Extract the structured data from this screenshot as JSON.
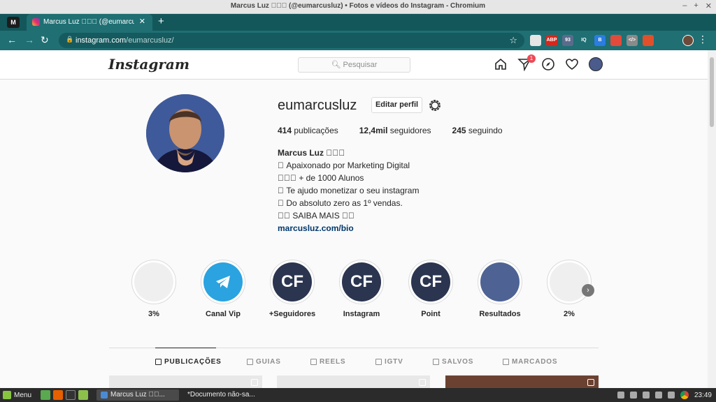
{
  "window": {
    "title": "Marcus Luz 󰀀󰀀󰀀 (@eumarcusluz) • Fotos e vídeos do Instagram - Chromium"
  },
  "browser": {
    "tab_title": "Marcus Luz 󰀀󰀀󰀀 (@eumarcusluz) • Instagram",
    "url_host": "instagram.com",
    "url_path": "/eumarcusluz/",
    "extensions": [
      {
        "name": "ext-icon",
        "label": "",
        "color": "#e5e5e5"
      },
      {
        "name": "adblock-plus-icon",
        "label": "ABP",
        "color": "#d9261c"
      },
      {
        "name": "ext-counter-icon",
        "label": "93",
        "color": "#5a6b8c"
      },
      {
        "name": "ext-iq-icon",
        "label": "IQ",
        "color": "#1f6f73"
      },
      {
        "name": "ext-b-icon",
        "label": "B",
        "color": "#2a7de1"
      },
      {
        "name": "ext-pin-icon",
        "label": "",
        "color": "#e24a3b"
      },
      {
        "name": "ext-code-icon",
        "label": "</>",
        "color": "#8a8a8a"
      },
      {
        "name": "ext-grid-icon",
        "label": "",
        "color": "#e0502b"
      },
      {
        "name": "puzzle-icon",
        "label": "",
        "color": "#1f6f73"
      }
    ]
  },
  "instagram": {
    "logo": "Instagram",
    "search_placeholder": "Pesquisar",
    "notification_count": "1"
  },
  "profile": {
    "username": "eumarcusluz",
    "edit_label": "Editar perfil",
    "stats": [
      {
        "value": "414",
        "label": "publicações"
      },
      {
        "value": "12,4mil",
        "label": "seguidores"
      },
      {
        "value": "245",
        "label": "seguindo"
      }
    ],
    "bio": {
      "name": "Marcus Luz 󰀀󰀀󰀀",
      "lines": [
        "󰀀 Apaixonado por Marketing Digital",
        "󰀀󰀀󰀀 + de 1000 Alunos",
        "󰀀 Te ajudo monetizar o seu instagram",
        "󰀀 Do absoluto zero as 1º vendas.",
        "󰀀󰀀 SAIBA MAIS 󰀀󰀀"
      ],
      "link": "marcusluz.com/bio"
    }
  },
  "highlights": [
    {
      "label": "3%",
      "type": "blank",
      "color": "#efefef",
      "text": ""
    },
    {
      "label": "Canal Vip",
      "type": "telegram",
      "color": "#2aa3e0",
      "text": ""
    },
    {
      "label": "+Seguidores",
      "type": "cf",
      "color": "#2b3550",
      "text": "CF"
    },
    {
      "label": "Instagram",
      "type": "cf",
      "color": "#2b3550",
      "text": "CF"
    },
    {
      "label": "Point",
      "type": "cf",
      "color": "#2b3550",
      "text": "CF"
    },
    {
      "label": "Resultados",
      "type": "solid",
      "color": "#4e6394",
      "text": ""
    },
    {
      "label": "2%",
      "type": "blank",
      "color": "#efefef",
      "text": ""
    }
  ],
  "profile_tabs": [
    {
      "label": "PUBLICAÇÕES",
      "icon": "grid-icon",
      "active": true
    },
    {
      "label": "GUIAS",
      "icon": "guide-icon",
      "active": false
    },
    {
      "label": "REELS",
      "icon": "reels-icon",
      "active": false
    },
    {
      "label": "IGTV",
      "icon": "igtv-icon",
      "active": false
    },
    {
      "label": "SALVOS",
      "icon": "bookmark-icon",
      "active": false
    },
    {
      "label": "MARCADOS",
      "icon": "tagged-icon",
      "active": false
    }
  ],
  "taskbar": {
    "menu_label": "Menu",
    "windows": [
      {
        "label": "Marcus Luz 󰀀󰀀...",
        "active": true
      },
      {
        "label": "*Documento não-sa...",
        "active": false
      }
    ],
    "clock": "23:49"
  }
}
